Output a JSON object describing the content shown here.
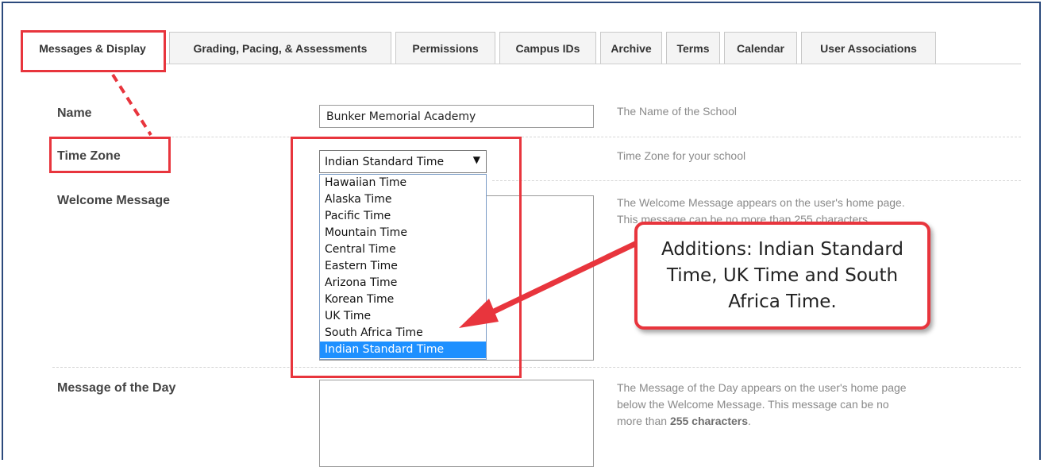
{
  "tabs": [
    {
      "label": "Messages & Display",
      "active": true
    },
    {
      "label": "Grading, Pacing, & Assessments",
      "active": false
    },
    {
      "label": "Permissions",
      "active": false
    },
    {
      "label": "Campus IDs",
      "active": false
    },
    {
      "label": "Archive",
      "active": false
    },
    {
      "label": "Terms",
      "active": false
    },
    {
      "label": "Calendar",
      "active": false
    },
    {
      "label": "User Associations",
      "active": false
    }
  ],
  "form": {
    "name": {
      "label": "Name",
      "value": "Bunker Memorial Academy",
      "help": "The Name of the School"
    },
    "time_zone": {
      "label": "Time Zone",
      "selected": "Indian Standard Time",
      "help": "Time Zone for your school",
      "options": [
        "Hawaiian Time",
        "Alaska Time",
        "Pacific Time",
        "Mountain Time",
        "Central Time",
        "Eastern Time",
        "Arizona Time",
        "Korean Time",
        "UK Time",
        "South Africa Time",
        "Indian Standard Time"
      ]
    },
    "welcome": {
      "label": "Welcome Message",
      "help_line1": "The Welcome Message appears on the user's home page.",
      "help_line2": "This message can be no more than 255 characters."
    },
    "motd": {
      "label": "Message of the Day",
      "help_line1": "The Message of the Day appears on the user's home page",
      "help_line2": "below the Welcome Message. This message can be no",
      "help_line3_prefix": "more than ",
      "help_line3_bold": "255 characters",
      "help_line3_suffix": "."
    }
  },
  "annotation": {
    "callout_text": "Additions: Indian Standard Time, UK Time and South Africa Time.",
    "color": "#e8353d"
  },
  "colors": {
    "frame": "#2c4a7c",
    "dropdown_highlight": "#1e90ff"
  }
}
